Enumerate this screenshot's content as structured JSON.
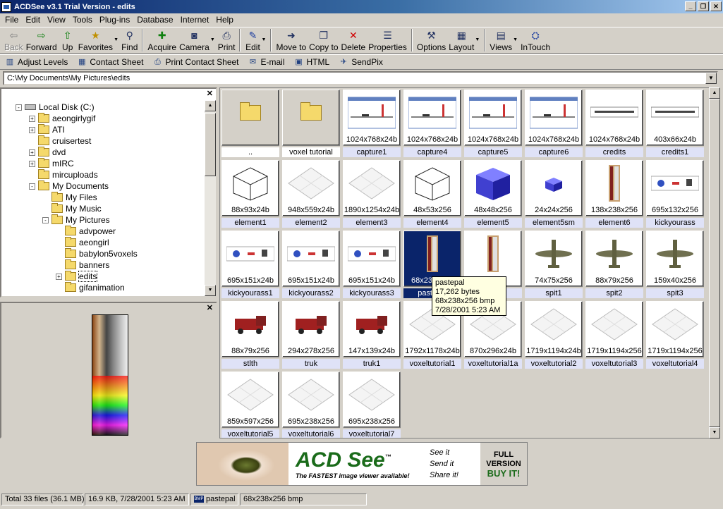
{
  "window": {
    "title": "ACDSee v3.1 Trial Version - edits"
  },
  "menu": [
    "File",
    "Edit",
    "View",
    "Tools",
    "Plug-ins",
    "Database",
    "Internet",
    "Help"
  ],
  "toolbar": [
    {
      "label": "Back",
      "icon": "back-icon",
      "disabled": true
    },
    {
      "label": "Forward",
      "icon": "forward-icon"
    },
    {
      "label": "Up",
      "icon": "up-icon"
    },
    {
      "label": "Favorites",
      "icon": "favorites-icon",
      "dropdown": true
    },
    {
      "label": "Find",
      "icon": "binoculars-icon"
    },
    {
      "label": "Acquire",
      "icon": "acquire-icon"
    },
    {
      "label": "Camera",
      "icon": "camera-icon",
      "dropdown": true
    },
    {
      "label": "Print",
      "icon": "printer-icon"
    },
    {
      "label": "Edit",
      "icon": "edit-icon",
      "dropdown": true
    },
    {
      "label": "Move to",
      "icon": "move-icon"
    },
    {
      "label": "Copy to",
      "icon": "copy-icon"
    },
    {
      "label": "Delete",
      "icon": "delete-icon"
    },
    {
      "label": "Properties",
      "icon": "properties-icon"
    },
    {
      "label": "Options",
      "icon": "options-icon"
    },
    {
      "label": "Layout",
      "icon": "layout-icon",
      "dropdown": true
    },
    {
      "label": "Views",
      "icon": "views-icon",
      "dropdown": true
    },
    {
      "label": "InTouch",
      "icon": "intouch-icon"
    }
  ],
  "toolbar2": [
    {
      "label": "Adjust Levels",
      "icon": "levels-icon"
    },
    {
      "label": "Contact Sheet",
      "icon": "contact-sheet-icon"
    },
    {
      "label": "Print Contact Sheet",
      "icon": "print-contact-icon"
    },
    {
      "label": "E-mail",
      "icon": "email-icon"
    },
    {
      "label": "HTML",
      "icon": "html-icon"
    },
    {
      "label": "SendPix",
      "icon": "sendpix-icon"
    }
  ],
  "address": "C:\\My Documents\\My Pictures\\edits",
  "tree": [
    {
      "label": "Local Disk (C:)",
      "level": 0,
      "exp": "-",
      "type": "drive"
    },
    {
      "label": "aeongirlygif",
      "level": 1,
      "exp": "+"
    },
    {
      "label": "ATI",
      "level": 1,
      "exp": "+"
    },
    {
      "label": "cruisertest",
      "level": 1,
      "exp": ""
    },
    {
      "label": "dvd",
      "level": 1,
      "exp": "+"
    },
    {
      "label": "mIRC",
      "level": 1,
      "exp": "+"
    },
    {
      "label": "mircuploads",
      "level": 1,
      "exp": ""
    },
    {
      "label": "My Documents",
      "level": 1,
      "exp": "-"
    },
    {
      "label": "My Files",
      "level": 2,
      "exp": ""
    },
    {
      "label": "My Music",
      "level": 2,
      "exp": ""
    },
    {
      "label": "My Pictures",
      "level": 2,
      "exp": "-"
    },
    {
      "label": "advpower",
      "level": 3,
      "exp": ""
    },
    {
      "label": "aeongirl",
      "level": 3,
      "exp": ""
    },
    {
      "label": "babylon5voxels",
      "level": 3,
      "exp": ""
    },
    {
      "label": "banners",
      "level": 3,
      "exp": ""
    },
    {
      "label": "edits",
      "level": 3,
      "exp": "+",
      "selected": true
    },
    {
      "label": "gifanimation",
      "level": 3,
      "exp": ""
    }
  ],
  "files": [
    {
      "name": "..",
      "dim": "",
      "type": "parent"
    },
    {
      "name": "voxel tutorial",
      "dim": "",
      "type": "folder"
    },
    {
      "name": "capture1",
      "dim": "1024x768x24b",
      "type": "screen"
    },
    {
      "name": "capture4",
      "dim": "1024x768x24b",
      "type": "screen"
    },
    {
      "name": "capture5",
      "dim": "1024x768x24b",
      "type": "screen"
    },
    {
      "name": "capture6",
      "dim": "1024x768x24b",
      "type": "screen"
    },
    {
      "name": "credits",
      "dim": "1024x768x24b",
      "type": "text"
    },
    {
      "name": "credits1",
      "dim": "403x66x24b",
      "type": "text"
    },
    {
      "name": "element1",
      "dim": "88x93x24b",
      "type": "wirecube"
    },
    {
      "name": "element2",
      "dim": "948x559x24b",
      "type": "grid"
    },
    {
      "name": "element3",
      "dim": "1890x1254x24b",
      "type": "grid"
    },
    {
      "name": "element4",
      "dim": "48x53x256",
      "type": "wirecube"
    },
    {
      "name": "element5",
      "dim": "48x48x256",
      "type": "bluecube"
    },
    {
      "name": "element5sm",
      "dim": "24x24x256",
      "type": "smallcube"
    },
    {
      "name": "element6",
      "dim": "138x238x256",
      "type": "palette"
    },
    {
      "name": "kickyourass",
      "dim": "695x132x256",
      "type": "strip"
    },
    {
      "name": "kickyourass1",
      "dim": "695x151x24b",
      "type": "strip"
    },
    {
      "name": "kickyourass2",
      "dim": "695x151x24b",
      "type": "strip"
    },
    {
      "name": "kickyourass3",
      "dim": "695x151x24b",
      "type": "strip"
    },
    {
      "name": "pastepal",
      "dim": "68x238x256",
      "type": "palette",
      "selected": true
    },
    {
      "name": "",
      "dim": "",
      "type": "palette"
    },
    {
      "name": "spit1",
      "dim": "74x75x256",
      "type": "plane"
    },
    {
      "name": "spit2",
      "dim": "88x79x256",
      "type": "plane"
    },
    {
      "name": "spit3",
      "dim": "159x40x256",
      "type": "plane"
    },
    {
      "name": "stlth",
      "dim": "88x79x256",
      "type": "truck"
    },
    {
      "name": "truk",
      "dim": "294x278x256",
      "type": "truck"
    },
    {
      "name": "truk1",
      "dim": "147x139x24b",
      "type": "truck"
    },
    {
      "name": "voxeltutorial1",
      "dim": "1792x1178x24b",
      "type": "grid"
    },
    {
      "name": "voxeltutorial1a",
      "dim": "870x296x24b",
      "type": "grid"
    },
    {
      "name": "voxeltutorial2",
      "dim": "1719x1194x24b",
      "type": "grid"
    },
    {
      "name": "voxeltutorial3",
      "dim": "1719x1194x256",
      "type": "grid"
    },
    {
      "name": "voxeltutorial4",
      "dim": "1719x1194x256",
      "type": "grid"
    },
    {
      "name": "voxeltutorial5",
      "dim": "859x597x256",
      "type": "grid"
    },
    {
      "name": "voxeltutorial6",
      "dim": "695x238x256",
      "type": "grid"
    },
    {
      "name": "voxeltutorial7",
      "dim": "695x238x256",
      "type": "grid"
    }
  ],
  "tooltip": {
    "line1": "pastepal",
    "line2": "17,262 bytes",
    "line3": "68x238x256 bmp",
    "line4": "7/28/2001 5:23 AM"
  },
  "banner": {
    "brand": "ACD See",
    "tm": "™",
    "tagline": "The FASTEST image viewer available!",
    "see": "See it",
    "send": "Send it",
    "share": "Share it!",
    "full": "FULL",
    "version": "VERSION",
    "buy": "BUY IT!"
  },
  "status": {
    "total": "Total 33 files (36.1 MB)",
    "info": "16.9 KB, 7/28/2001 5:23 AM",
    "bmp": "BMP",
    "name": "pastepal",
    "dims": "68x238x256 bmp"
  }
}
